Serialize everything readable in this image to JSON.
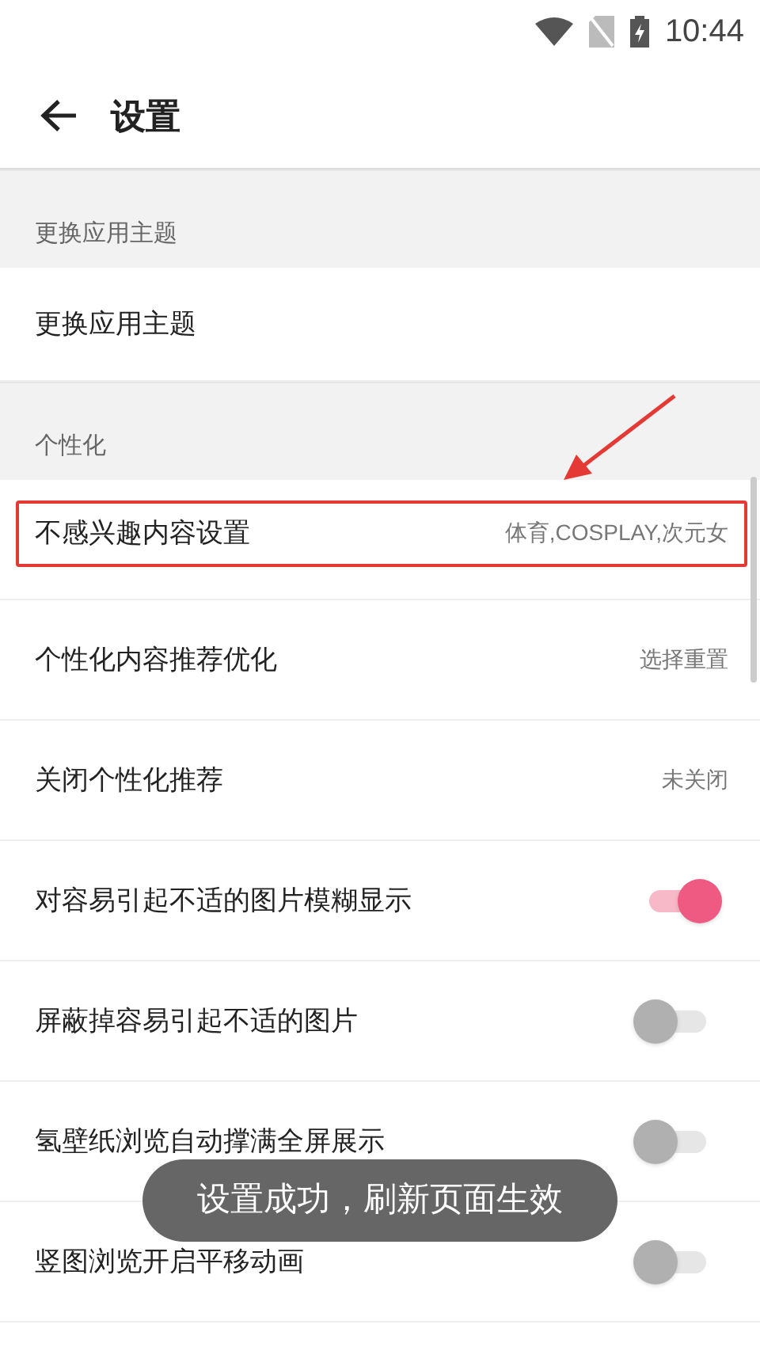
{
  "status_bar": {
    "time": "10:44"
  },
  "header": {
    "title": "设置"
  },
  "sections": [
    {
      "title": "更换应用主题",
      "items": [
        {
          "kind": "link",
          "label": "更换应用主题",
          "highlighted": false
        }
      ]
    },
    {
      "title": "个性化",
      "items": [
        {
          "kind": "value",
          "label": "不感兴趣内容设置",
          "value": "体育,COSPLAY,次元女",
          "highlighted": true
        },
        {
          "kind": "value",
          "label": "个性化内容推荐优化",
          "value": "选择重置",
          "highlighted": false
        },
        {
          "kind": "value",
          "label": "关闭个性化推荐",
          "value": "未关闭",
          "highlighted": false
        },
        {
          "kind": "switch",
          "label": "对容易引起不适的图片模糊显示",
          "on": true,
          "highlighted": false
        },
        {
          "kind": "switch",
          "label": "屏蔽掉容易引起不适的图片",
          "on": false,
          "highlighted": false
        },
        {
          "kind": "switch",
          "label": "氢壁纸浏览自动撑满全屏展示",
          "on": false,
          "highlighted": false
        },
        {
          "kind": "switch",
          "label": "竖图浏览开启平移动画",
          "on": false,
          "highlighted": false
        }
      ]
    }
  ],
  "toast": {
    "text": "设置成功，刷新页面生效"
  }
}
